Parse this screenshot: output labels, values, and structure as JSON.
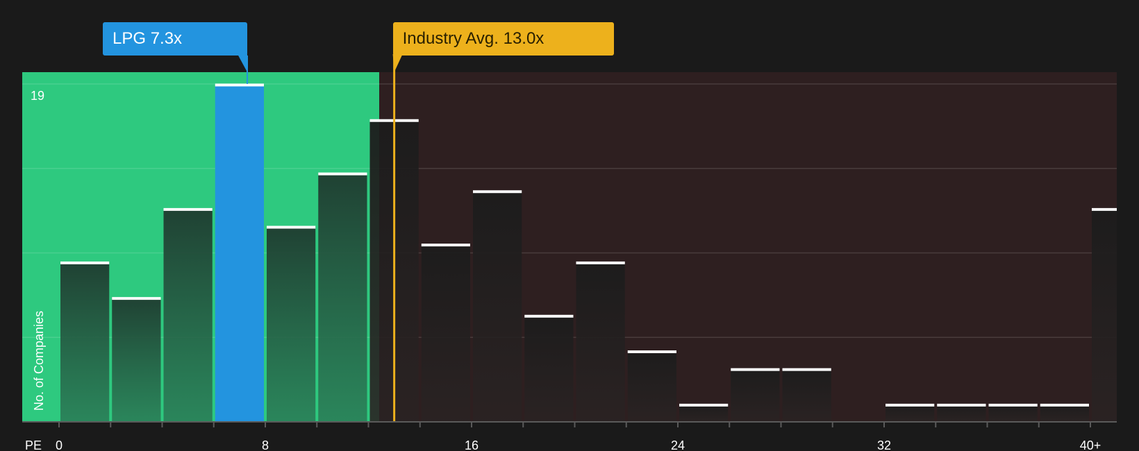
{
  "chart_data": {
    "type": "bar",
    "ylabel": "No. of Companies",
    "xlabel": "PE",
    "y_tick_label": "19",
    "ylim": [
      0,
      19
    ],
    "x_tick_labels": [
      "0",
      "8",
      "16",
      "24",
      "32",
      "40+"
    ],
    "x_tick_values": [
      0,
      8,
      16,
      24,
      32,
      40
    ],
    "bin_width": 2,
    "bins": [
      {
        "start": 0,
        "end": 2,
        "value": 9
      },
      {
        "start": 2,
        "end": 4,
        "value": 7
      },
      {
        "start": 4,
        "end": 6,
        "value": 12
      },
      {
        "start": 6,
        "end": 8,
        "value": 19,
        "highlight": true
      },
      {
        "start": 8,
        "end": 10,
        "value": 11
      },
      {
        "start": 10,
        "end": 12,
        "value": 14
      },
      {
        "start": 12,
        "end": 14,
        "value": 17
      },
      {
        "start": 14,
        "end": 16,
        "value": 10
      },
      {
        "start": 16,
        "end": 18,
        "value": 13
      },
      {
        "start": 18,
        "end": 20,
        "value": 6
      },
      {
        "start": 20,
        "end": 22,
        "value": 9
      },
      {
        "start": 22,
        "end": 24,
        "value": 4
      },
      {
        "start": 24,
        "end": 26,
        "value": 1
      },
      {
        "start": 26,
        "end": 28,
        "value": 3
      },
      {
        "start": 28,
        "end": 30,
        "value": 3
      },
      {
        "start": 30,
        "end": 32,
        "value": 0
      },
      {
        "start": 32,
        "end": 34,
        "value": 1
      },
      {
        "start": 34,
        "end": 36,
        "value": 1
      },
      {
        "start": 36,
        "end": 38,
        "value": 1
      },
      {
        "start": 38,
        "end": 40,
        "value": 1
      },
      {
        "start": 40,
        "end": 42,
        "value": 12
      }
    ],
    "company": {
      "label": "LPG 7.3x",
      "value": 7.3
    },
    "industry_avg": {
      "label": "Industry Avg. 13.0x",
      "value": 13.0
    },
    "colors": {
      "background": "#1a1a1a",
      "good_zone": "#2ec97f",
      "bad_zone": "#2e1f20",
      "highlight_bar": "#2394df",
      "bar": "#1f2a25",
      "industry_line": "#edb11c"
    }
  }
}
